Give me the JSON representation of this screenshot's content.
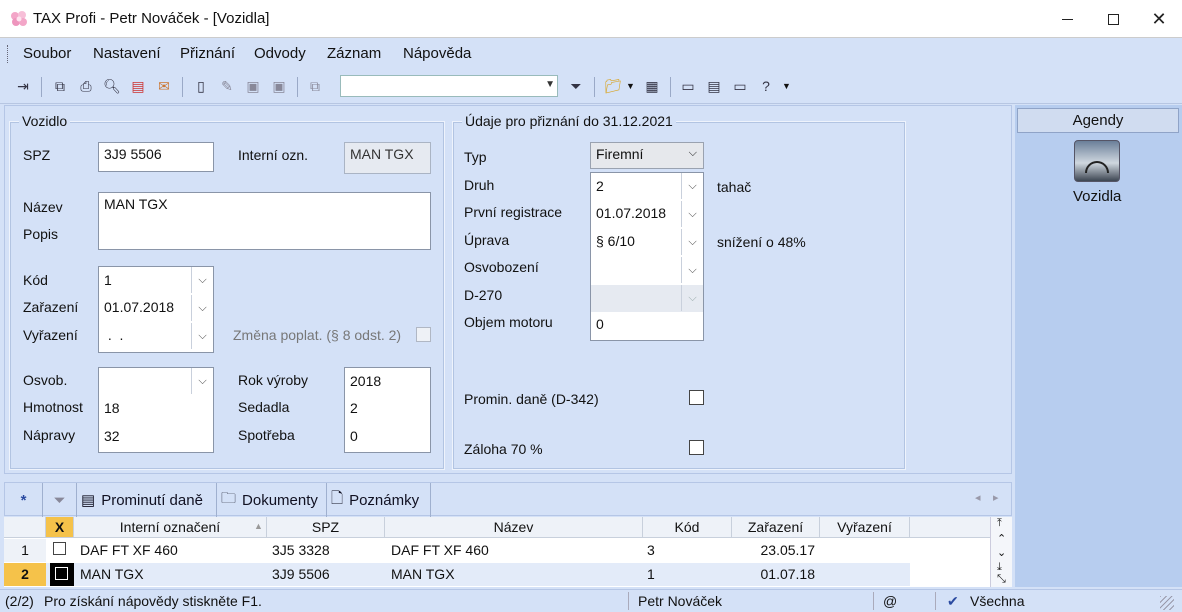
{
  "window": {
    "title": "TAX Profi - Petr Nováček - [Vozidla]"
  },
  "menu": [
    "Soubor",
    "Nastavení",
    "Přiznání",
    "Odvody",
    "Záznam",
    "Nápověda"
  ],
  "vozidlo": {
    "legend": "Vozidlo",
    "spz_label": "SPZ",
    "spz": "3J9 5506",
    "interni_label": "Interní ozn.",
    "interni": "MAN TGX",
    "nazev_label": "Název",
    "nazev": "MAN TGX",
    "popis_label": "Popis",
    "kod_label": "Kód",
    "kod": "1",
    "zarazeni_label": "Zařazení",
    "zarazeni": "01.07.2018",
    "vyrazeni_label": "Vyřazení",
    "vyrazeni": " .  .",
    "zmena_label": "Změna poplat. (§ 8 odst. 2)",
    "osvob_label": "Osvob.",
    "osvob": "",
    "hmotnost_label": "Hmotnost",
    "hmotnost": "18",
    "napravy_label": "Nápravy",
    "napravy": "32",
    "rok_label": "Rok výroby",
    "rok": "2018",
    "sedadla_label": "Sedadla",
    "sedadla": "2",
    "spotreba_label": "Spotřeba",
    "spotreba": "0"
  },
  "udaje": {
    "legend": "Údaje pro přiznání do 31.12.2021",
    "typ_label": "Typ",
    "typ": "Firemní",
    "druh_label": "Druh",
    "druh": "2",
    "druh_desc": "tahač",
    "registrace_label": "První registrace",
    "registrace": "01.07.2018",
    "uprava_label": "Úprava",
    "uprava": "§ 6/10",
    "uprava_desc": "snížení o 48%",
    "osvobozeni_label": "Osvobození",
    "osvobozeni": "",
    "d270_label": "D-270",
    "d270": "",
    "objem_label": "Objem motoru",
    "objem": "0",
    "promin_label": "Promin. daně (D-342)",
    "zaloha_label": "Záloha 70 %"
  },
  "agendy": {
    "header": "Agendy",
    "item": "Vozidla"
  },
  "tabs": {
    "star": "*",
    "t1": "Prominutí daně",
    "t2": "Dokumenty",
    "t3": "Poznámky"
  },
  "grid": {
    "headers": {
      "x": "X",
      "interni": "Interní označení",
      "spz": "SPZ",
      "nazev": "Název",
      "kod": "Kód",
      "zarazeni": "Zařazení",
      "vyrazeni": "Vyřazení"
    },
    "rows": [
      {
        "n": "1",
        "interni": "DAF FT XF 460",
        "spz": "3J5 3328",
        "nazev": "DAF FT XF 460",
        "kod": "3",
        "zarazeni": "23.05.17",
        "vyrazeni": ""
      },
      {
        "n": "2",
        "interni": "MAN TGX",
        "spz": "3J9 5506",
        "nazev": "MAN TGX",
        "kod": "1",
        "zarazeni": "01.07.18",
        "vyrazeni": ""
      }
    ]
  },
  "status": {
    "count": "(2/2)",
    "hint": "Pro získání nápovědy stiskněte F1.",
    "user": "Petr Nováček",
    "at": "@",
    "filter": "Všechna"
  },
  "colors": {
    "background": "#d4e1f7",
    "selected_row_num": "#f5c24a",
    "agendy_panel": "#b7cdef"
  }
}
